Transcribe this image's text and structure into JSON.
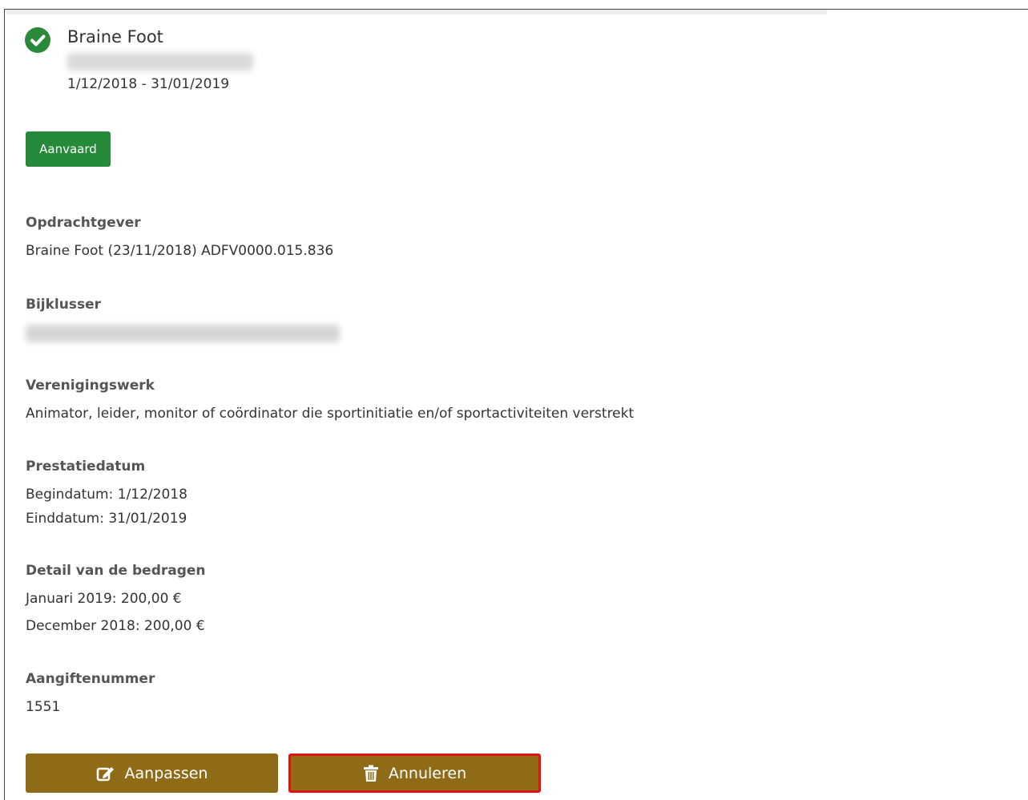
{
  "header": {
    "title": "Braine Foot",
    "period": "1/12/2018 - 31/01/2019",
    "status_icon": "check-circle-icon"
  },
  "status": {
    "label": "Aanvaard",
    "color": "#258a39"
  },
  "sections": {
    "opdrachtgever": {
      "label": "Opdrachtgever",
      "value": "Braine Foot (23/11/2018) ADFV0000.015.836"
    },
    "bijklusser": {
      "label": "Bijklusser"
    },
    "verenigingswerk": {
      "label": "Verenigingswerk",
      "value": "Animator, leider, monitor of coördinator die sportinitiatie en/of sportactiviteiten verstrekt"
    },
    "prestatiedatum": {
      "label": "Prestatiedatum",
      "begin": "Begindatum: 1/12/2018",
      "end": "Einddatum: 31/01/2019"
    },
    "bedragen": {
      "label": "Detail van de bedragen",
      "lines": [
        "Januari 2019: 200,00 €",
        "December 2018: 200,00 €"
      ]
    },
    "aangiftenummer": {
      "label": "Aangiftenummer",
      "value": "1551"
    }
  },
  "actions": {
    "edit": {
      "label": "Aanpassen",
      "icon": "edit-icon"
    },
    "cancel": {
      "label": "Annuleren",
      "icon": "trash-icon"
    }
  },
  "colors": {
    "accent": "#8f6a17",
    "success": "#2a8a3a",
    "highlight": "#e01313"
  }
}
